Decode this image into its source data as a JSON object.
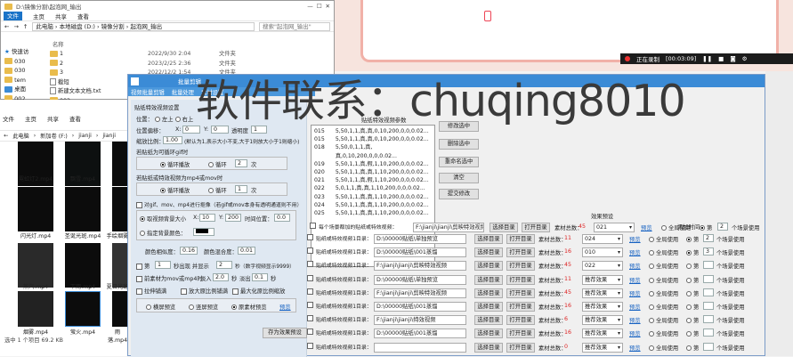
{
  "explorer": {
    "title": "D:\\镜像分割\\起泡网_输出",
    "ribbon": [
      "文件",
      "主页",
      "共享",
      "查看"
    ],
    "breadcrumb": [
      "此电脑",
      "本地磁盘 (D:)",
      "镜像分割",
      "起泡网_输出"
    ],
    "search_placeholder": "搜索\"起泡网_输出\"",
    "header": "名称",
    "tree": [
      "快速访",
      "030",
      "030",
      "tem",
      "桌面",
      "002"
    ],
    "files": [
      {
        "name": "1",
        "date": "2022/9/30 2:04",
        "type": "文件夹"
      },
      {
        "name": "2",
        "date": "2023/2/25 2:36",
        "type": "文件夹"
      },
      {
        "name": "3",
        "date": "2022/12/2 1:54",
        "type": "文件夹"
      },
      {
        "name": "截短",
        "date": "",
        "type": ""
      },
      {
        "name": "新建文本文档.txt",
        "date": "",
        "type": ""
      },
      {
        "name": "002",
        "date": "",
        "type": ""
      }
    ]
  },
  "explorer2": {
    "ribbon": [
      "文件",
      "主页",
      "共享",
      "查看",
      "播放",
      "视频工具"
    ],
    "breadcrumb": [
      "此电脑",
      "新加卷 (F:)",
      "jianji",
      "jianji"
    ],
    "thumbs": [
      "霓虹灯2.mp4",
      "飘雪.mp4",
      "闪光灯.mp4",
      "圣诞光斑.mp4",
      "手绘烟雾",
      "蒸汽.mp4",
      "下雨.mp4",
      "夏日光斑",
      "烟雾.mp4",
      "萤火.mp4",
      "雨落.mp4"
    ],
    "status": "选中 1 个项目 69.2 KB"
  },
  "screen_recorder": {
    "label": "正在录制",
    "time": "[00:03:09]"
  },
  "dialog": {
    "title": "批量剪辑",
    "tabs": [
      "视频批量剪辑",
      "批量处理",
      "素材设置"
    ],
    "sticker_group": "贴纸特效视频设置",
    "pos_label": "位置：",
    "pos_options": [
      "左上",
      "右上",
      "左下",
      "右下",
      "自定义",
      "随机"
    ],
    "pos_offset_label": "位置偏移：",
    "x_label": "X:",
    "x_val": "0",
    "y_label": "Y:",
    "y_val": "0",
    "opacity_label": "透明度",
    "opacity_val": "1",
    "scale_label": "缩放比例：",
    "scale_val": "1.00",
    "scale_note": "(默认为1,表示大小不变,大于1则放大小于1则缩小)",
    "gif_group": "若贴纸为可循环gif时",
    "gif_loop": "循环播放",
    "gif_count_label": "循环",
    "gif_count": "2",
    "gif_unit": "次",
    "mov_group": "若贴纸或特效视频为mp4或mov时",
    "mov_loop": "循环播放",
    "mov_count_label": "循环",
    "mov_count": "1",
    "mov_unit": "次",
    "transparency_check": "对gif、mov、mp4进行抠像（若gif或mov本身有透明通道则不用）",
    "bg_size_label": "取视频背景大小",
    "bg_x": "10",
    "bg_y": "200",
    "time_pos_label": "时间位置：",
    "time_pos": "0.0",
    "custom_bg": "指定背景颜色：",
    "color_sim_label": "颜色相似度：",
    "color_sim": "0.16",
    "blend_label": "颜色混合度：",
    "blend": "0.01",
    "nth_label": "第",
    "nth": "1",
    "nth_suffix": "秒出现 并显示",
    "show_secs": "2",
    "show_suffix": "秒（数字视频显示9999）",
    "fade_label": "前素材为mov或mp4时",
    "fade_in_label": "淡入",
    "fade_in": "2.0",
    "fade_out_label": "淡出",
    "fade_out": "0.1",
    "sec": "秒",
    "stretch_cb": "拉伸铺满",
    "enlarge_cb": "放大原比例铺满",
    "keep_cb": "最大化原比例缩放",
    "preview_opts": [
      "横屏预览",
      "竖屏预览",
      "原素材预览"
    ],
    "preview_link": "预览",
    "save_btn": "存为效果预设",
    "params_header": "贴纸特效视频参数",
    "params": [
      [
        "015",
        "5,50,1,1,真,真,0,10,200,0,0,0.02..."
      ],
      [
        "015",
        "5,50,1,1,真,真,0,10,200,0,0,0.02..."
      ],
      [
        "018",
        "5,50,0,1,1,真,真,0,10,200,0,0,0.02..."
      ],
      [
        "019",
        "5,50,1,1,真,假,1,10,200,0,0,0.02..."
      ],
      [
        "020",
        "5,50,1,1,真,真,1,10,200,0,0,0.02..."
      ],
      [
        "021",
        "5,50,1,1,真,假,1,10,200,0,0,0.02..."
      ],
      [
        "022",
        "5,0,1,1,真,真,1,10,200,0,0,0.02..."
      ],
      [
        "023",
        "5,50,1,1,真,真,1,10,200,0,0,0.02..."
      ],
      [
        "024",
        "5,50,1,1,真,真,1,10,200,0,0,0.02..."
      ],
      [
        "025",
        "5,50,1,1,真,真,1,10,200,0,0,0.02..."
      ]
    ],
    "side_buttons": [
      "修改选中",
      "删除选中",
      "重命名选中",
      "清空",
      "提交修改"
    ],
    "effect_preset_header": "效果预设",
    "add_time_header": "添加时间",
    "first_row_label": "每个场景都加的贴纸或特效视频：",
    "first_row_path": "F:\\jianji\\jianji\\剪映特效视频",
    "row_label": "贴纸或特效视频1目录：",
    "select_dir": "选择目录",
    "open_dir": "打开目录",
    "count_label": "素材总数：",
    "preview": "预览",
    "use_all": "全局使用",
    "nth_scene": "第",
    "scene_suffix": "个场景使用",
    "rows": [
      {
        "path": "D:\\00000贴纸\\单独预览",
        "count": "11",
        "preset": "024",
        "scene": "2"
      },
      {
        "path": "D:\\00000贴纸\\001蒸馏",
        "count": "16",
        "preset": "010",
        "scene": "3"
      },
      {
        "path": "F:\\jianji\\jianji\\剪映特效视频",
        "count": "45",
        "preset": "022",
        "scene": ""
      },
      {
        "path": "D:\\00000贴纸\\单独预览",
        "count": "11",
        "preset": "推荐效果",
        "scene": ""
      },
      {
        "path": "F:\\jianji\\jianji\\剪映特效视频",
        "count": "45",
        "preset": "推荐效果",
        "scene": ""
      },
      {
        "path": "D:\\00000贴纸\\001蒸馏",
        "count": "16",
        "preset": "推荐效果",
        "scene": ""
      },
      {
        "path": "F:\\jianji\\jianji\\特效视频",
        "count": "6",
        "preset": "推荐效果",
        "scene": ""
      },
      {
        "path": "D:\\00000贴纸\\001蒸馏",
        "count": "16",
        "preset": "推荐效果",
        "scene": ""
      },
      {
        "path": "",
        "count": "0",
        "preset": "推荐效果",
        "scene": ""
      }
    ],
    "first_preset": "021",
    "first_count": "45",
    "first_scene": "2"
  },
  "watermark": "软件联系：chuqing8010",
  "colors": {
    "accent": "#3b8bd6",
    "red": "#dd2222",
    "pink": "#f1b1a8"
  }
}
